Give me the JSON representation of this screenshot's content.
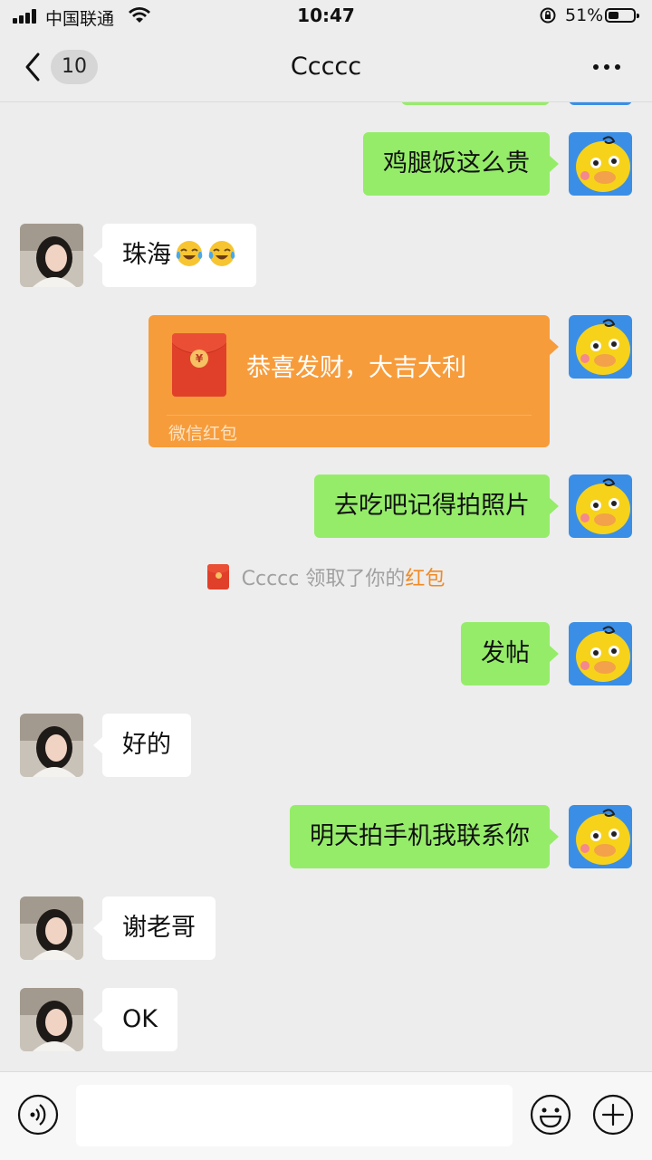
{
  "status_bar": {
    "carrier": "中国联通",
    "time": "10:47",
    "battery_percent": "51%",
    "battery_level": 0.51
  },
  "nav": {
    "unread_count": "10",
    "title": "Ccccc"
  },
  "messages": [
    {
      "side": "sent",
      "text": "鸡腿饭这么贵"
    },
    {
      "side": "recv",
      "text": "珠海",
      "emojis": [
        "face-with-tears-of-joy",
        "face-with-tears-of-joy"
      ]
    },
    {
      "side": "sent",
      "type": "red_packet",
      "title": "恭喜发财，大吉大利",
      "footer": "微信红包"
    },
    {
      "side": "sent",
      "text": "去吃吧记得拍照片"
    },
    {
      "type": "system",
      "prefix": "Ccccc 领取了你的",
      "link": "红包"
    },
    {
      "side": "sent",
      "text": "发帖"
    },
    {
      "side": "recv",
      "text": "好的"
    },
    {
      "side": "sent",
      "text": "明天拍手机我联系你"
    },
    {
      "side": "recv",
      "text": "谢老哥"
    },
    {
      "side": "recv",
      "text": "OK"
    }
  ],
  "input_bar": {
    "placeholder": ""
  },
  "colors": {
    "sent_bubble": "#95ec69",
    "recv_bubble": "#ffffff",
    "red_packet": "#f79c3b",
    "background": "#ededed",
    "link": "#f08a24"
  }
}
